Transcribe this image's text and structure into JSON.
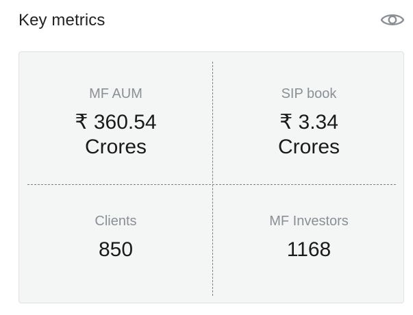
{
  "header": {
    "title": "Key metrics",
    "visibility_icon": "eye-icon"
  },
  "metrics": [
    {
      "label": "MF AUM",
      "value_line1": "₹ 360.54",
      "value_line2": "Crores"
    },
    {
      "label": "SIP book",
      "value_line1": "₹ 3.34",
      "value_line2": "Crores"
    },
    {
      "label": "Clients",
      "value_line1": "850",
      "value_line2": ""
    },
    {
      "label": "MF Investors",
      "value_line1": "1168",
      "value_line2": ""
    }
  ],
  "colors": {
    "card_background": "#f4f5f5",
    "label_text": "#8a9095",
    "value_text": "#1a1a1a"
  }
}
